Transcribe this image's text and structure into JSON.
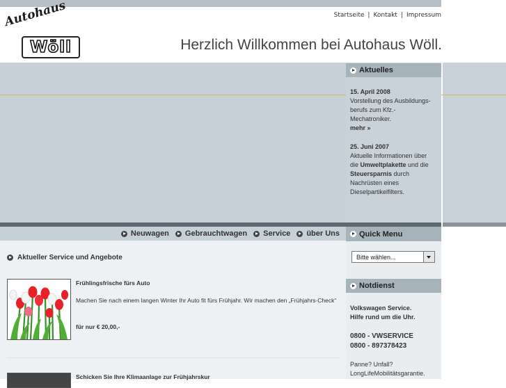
{
  "header": {
    "logo_script": "Autohaus",
    "logo_wordmark": "Wöll",
    "links": [
      "Startseite",
      "Kontakt",
      "Impressum"
    ],
    "welcome": "Herzlich Willkommen bei Autohaus Wöll."
  },
  "news": {
    "heading": "Aktuelles",
    "item1": {
      "date": "15. April 2008",
      "line1": "Vorstellung des Ausbildungs-",
      "line2": "berufs zum Kfz.-",
      "line3": "Mechatroniker.",
      "more": "mehr »"
    },
    "item2": {
      "date": "25. Juni 2007",
      "line1": "Aktuelle Informationen über",
      "line2a": "die ",
      "line2b": "Umweltplakette",
      "line2c": " und die",
      "line3a": "Steuersparnis",
      "line3b": " durch",
      "line4": "Nachrüsten eines",
      "line5": "Dieselpartikelfilters."
    }
  },
  "nav": {
    "items": [
      "Neuwagen",
      "Gebrauchtwagen",
      "Service",
      "über Uns"
    ]
  },
  "main": {
    "section_title": "Aktueller Service und Angebote",
    "teaser1": {
      "title": "Frühlingsfrische fürs Auto",
      "text": "Machen Sie nach einem langen Winter Ihr Auto fit fürs Frühjahr. Wir machen den „Frühjahrs-Check“",
      "price": "für nur € 20,00,-"
    },
    "teaser2": {
      "title": "Schicken Sie Ihre Klimaanlage zur Frühjahrskur"
    }
  },
  "quickmenu": {
    "heading": "Quick Menu",
    "select_value": "Bitte wählen..."
  },
  "notdienst": {
    "heading": "Notdienst",
    "line1": "Volkswagen Service.",
    "line2": "Hilfe rund um die Uhr.",
    "phone1": "0800 - VWSERVICE",
    "phone2": "0800 - 897378423",
    "line3": "Panne? Unfall?",
    "line4": "LongLifeMobilitätsgarantie."
  },
  "colors": {
    "hero_bg": "#c6d1d7",
    "accent_line": "#d8b45a",
    "sidebar_head": "#a7b3bb"
  }
}
